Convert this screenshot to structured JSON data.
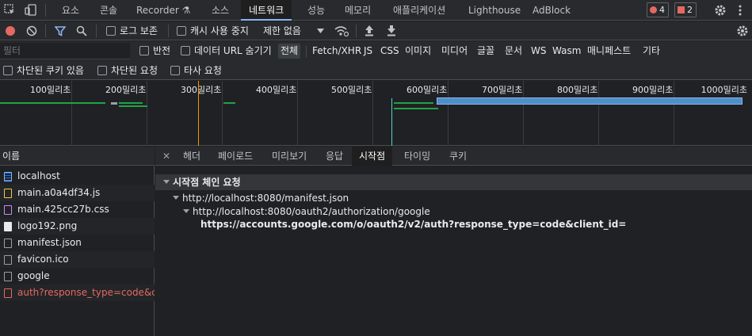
{
  "panel_tabs": [
    "요소",
    "콘솔",
    "Recorder",
    "소스",
    "네트워크",
    "성능",
    "메모리",
    "애플리케이션",
    "Lighthouse",
    "AdBlock"
  ],
  "recorder_flask": "⚗",
  "error_count": "4",
  "issue_count": "2",
  "toolbar": {
    "preserve_log": "로그 보존",
    "disable_cache": "캐시 사용 중지",
    "throttle": "제한 없음"
  },
  "filter": {
    "placeholder": "필터",
    "invert": "반전",
    "hide_data_urls": "데이터 URL 숨기기",
    "types": [
      "전체",
      "Fetch/XHR",
      "JS",
      "CSS",
      "이미지",
      "미디어",
      "글꼴",
      "문서",
      "WS",
      "Wasm",
      "매니페스트",
      "기타"
    ],
    "blocked_cookies": "차단된 쿠키 있음",
    "blocked_requests": "차단된 요청",
    "third_party": "타사 요청"
  },
  "overview_ticks": [
    "100밀리초",
    "200밀리초",
    "300밀리초",
    "400밀리초",
    "500밀리초",
    "600밀리초",
    "700밀리초",
    "800밀리초",
    "900밀리초",
    "1000밀리초"
  ],
  "name_header": "이름",
  "requests": [
    {
      "name": "localhost",
      "type": "doc"
    },
    {
      "name": "main.a0a4df34.js",
      "type": "js"
    },
    {
      "name": "main.425cc27b.css",
      "type": "css"
    },
    {
      "name": "logo192.png",
      "type": "img"
    },
    {
      "name": "manifest.json",
      "type": "other"
    },
    {
      "name": "favicon.ico",
      "type": "other"
    },
    {
      "name": "google",
      "type": "other"
    },
    {
      "name": "auth?response_type=code&cl...",
      "type": "error"
    }
  ],
  "detail_tabs": [
    "헤더",
    "페이로드",
    "미리보기",
    "응답",
    "시작점",
    "타이밍",
    "쿠키"
  ],
  "initiator": {
    "section_title": "시작점 체인 요청",
    "chain": [
      "http://localhost:8080/manifest.json",
      "http://localhost:8080/oauth2/authorization/google",
      "https://accounts.google.com/o/oauth2/v2/auth?response_type=code&client_id="
    ]
  },
  "colors": {
    "accent": "#8ab4f8",
    "error": "#e46962",
    "record": "#e46962",
    "bar_green": "#1ea446",
    "bar_blue": "#4e8fc6"
  }
}
